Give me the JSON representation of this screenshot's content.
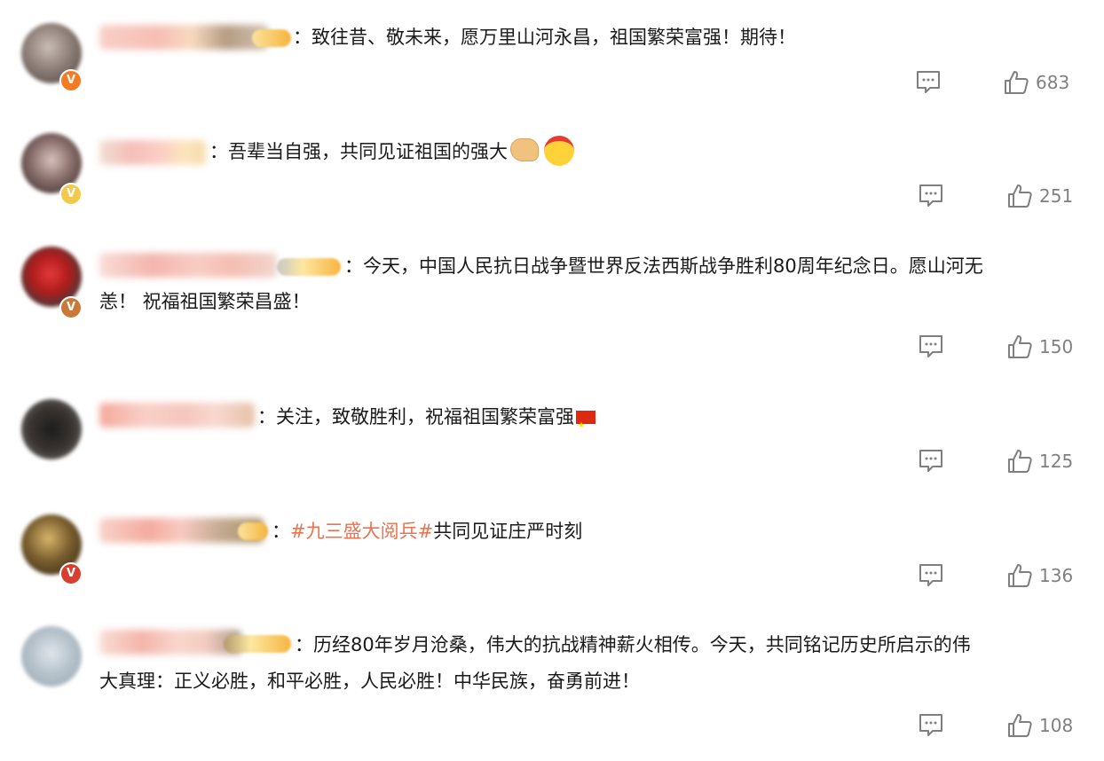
{
  "comments": [
    {
      "separator": "：",
      "text": "致往昔、敬未来，愿万里山河永昌，祖国繁荣富强！期待！",
      "likes": "683",
      "verified_badge": "V"
    },
    {
      "separator": "：",
      "text": "吾辈当自强，共同见证祖国的强大",
      "likes": "251",
      "verified_badge": "V"
    },
    {
      "separator": "：",
      "text_line1": "今天，中国人民抗日战争暨世界反法西斯战争胜利80周年纪念日。愿山河无",
      "text_line2": "恙！ 祝福祖国繁荣昌盛！",
      "likes": "150",
      "verified_badge": "V"
    },
    {
      "separator": "：",
      "text": "关注，致敬胜利，祝福祖国繁荣富强",
      "likes": "125"
    },
    {
      "separator": "：",
      "hashtag": "#九三盛大阅兵#",
      "text": "共同见证庄严时刻",
      "likes": "136",
      "verified_badge": "V"
    },
    {
      "separator": "：",
      "text_line1": "历经80年岁月沧桑，伟大的抗战精神薪火相传。今天，共同铭记历史所启示的伟",
      "text_line2": "大真理：正义必胜，和平必胜，人民必胜！中华民族，奋勇前进！",
      "likes": "108"
    }
  ],
  "icons": {
    "comment": "comment-bubble-icon",
    "like": "thumbs-up-icon",
    "emoji_muscle": "flexed-biceps-emoji",
    "emoji_fight": "fighting-headband-emoji",
    "emoji_flag": "china-flag-emoji"
  },
  "colors": {
    "text": "#1a1a1a",
    "hashtag": "#eb7350",
    "count": "#808080",
    "icon": "#7f7f7f",
    "badge_orange": "#f47b20"
  }
}
